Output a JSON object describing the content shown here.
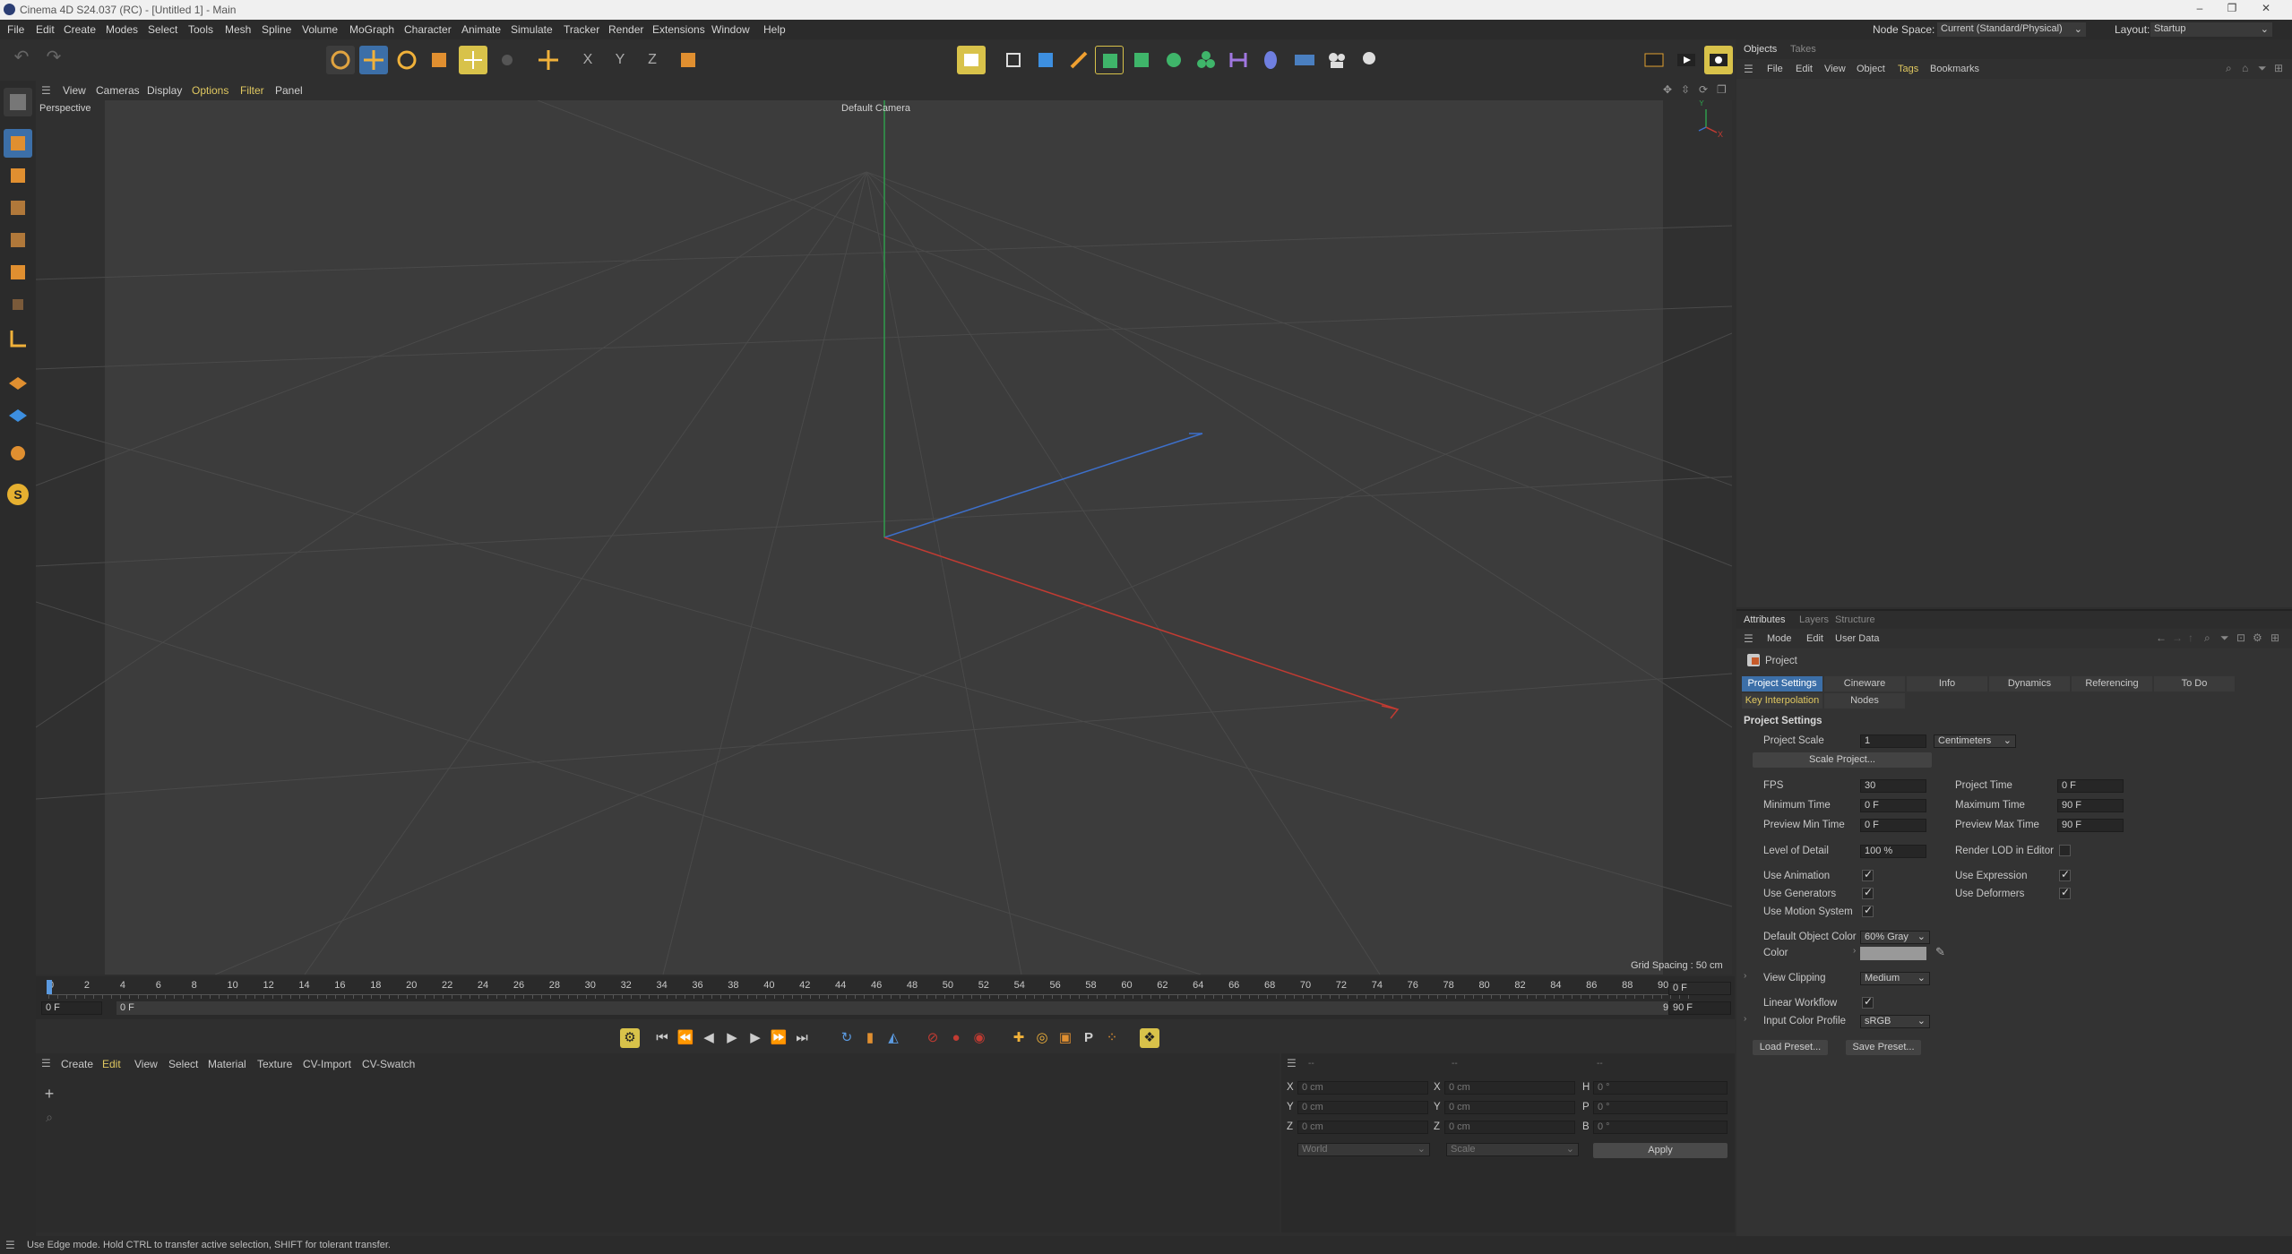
{
  "window": {
    "title": "Cinema 4D S24.037 (RC) - [Untitled 1] - Main"
  },
  "menu": {
    "items": [
      "File",
      "Edit",
      "Create",
      "Modes",
      "Select",
      "Tools",
      "Mesh",
      "Spline",
      "Volume",
      "MoGraph",
      "Character",
      "Animate",
      "Simulate",
      "Tracker",
      "Render",
      "Extensions",
      "Window",
      "Help"
    ],
    "node_space_label": "Node Space:",
    "node_space_value": "Current (Standard/Physical)",
    "layout_label": "Layout:",
    "layout_value": "Startup"
  },
  "viewport": {
    "menu": [
      "View",
      "Cameras",
      "Display",
      "Options",
      "Filter",
      "Panel"
    ],
    "projection": "Perspective",
    "camera": "Default Camera",
    "grid_spacing": "Grid Spacing : 50 cm",
    "axis_y": "Y",
    "axis_x": "X"
  },
  "timeline": {
    "ticks": [
      "0",
      "2",
      "4",
      "6",
      "8",
      "10",
      "12",
      "14",
      "16",
      "18",
      "20",
      "22",
      "24",
      "26",
      "28",
      "30",
      "32",
      "34",
      "36",
      "38",
      "40",
      "42",
      "44",
      "46",
      "48",
      "50",
      "52",
      "54",
      "56",
      "58",
      "60",
      "62",
      "64",
      "66",
      "68",
      "70",
      "72",
      "74",
      "76",
      "78",
      "80",
      "82",
      "84",
      "86",
      "88",
      "90"
    ],
    "current_frame": "0 F",
    "start_field": "0 F",
    "range_start": "0 F",
    "range_end": "90 F",
    "end_field": "90 F"
  },
  "material_manager": {
    "menu": [
      "Create",
      "Edit",
      "View",
      "Select",
      "Material",
      "Texture",
      "CV-Import",
      "CV-Swatch"
    ]
  },
  "coordinates": {
    "headers": [
      "--",
      "--",
      "--"
    ],
    "rows": [
      {
        "a": "X",
        "va": "0 cm",
        "b": "X",
        "vb": "0 cm",
        "c": "H",
        "vc": "0 °"
      },
      {
        "a": "Y",
        "va": "0 cm",
        "b": "Y",
        "vb": "0 cm",
        "c": "P",
        "vc": "0 °"
      },
      {
        "a": "Z",
        "va": "0 cm",
        "b": "Z",
        "vb": "0 cm",
        "c": "B",
        "vc": "0 °"
      }
    ],
    "mode1": "World",
    "mode2": "Scale",
    "apply": "Apply"
  },
  "status": {
    "text": "Use Edge mode. Hold CTRL to transfer active selection, SHIFT for tolerant transfer."
  },
  "objects_panel": {
    "tabs": [
      "Objects",
      "Takes"
    ],
    "menu": [
      "File",
      "Edit",
      "View",
      "Object",
      "Tags",
      "Bookmarks"
    ]
  },
  "attributes": {
    "tabs": [
      "Attributes",
      "Layers",
      "Structure"
    ],
    "menu": [
      "Mode",
      "Edit",
      "User Data"
    ],
    "object_label": "Project",
    "tabs_row1": [
      "Project Settings",
      "Cineware",
      "Info",
      "Dynamics",
      "Referencing",
      "To Do"
    ],
    "tabs_row2": [
      "Key Interpolation",
      "Nodes"
    ],
    "section": "Project Settings",
    "project_scale_label": "Project Scale",
    "project_scale_value": "1",
    "project_scale_unit": "Centimeters",
    "scale_project_btn": "Scale Project...",
    "fps_label": "FPS",
    "fps_value": "30",
    "project_time_label": "Project Time",
    "project_time_value": "0 F",
    "min_time_label": "Minimum Time",
    "min_time_value": "0 F",
    "max_time_label": "Maximum Time",
    "max_time_value": "90 F",
    "prev_min_label": "Preview Min Time",
    "prev_min_value": "0 F",
    "prev_max_label": "Preview Max Time",
    "prev_max_value": "90 F",
    "lod_label": "Level of Detail",
    "lod_value": "100 %",
    "render_lod_label": "Render LOD in Editor",
    "use_animation": "Use Animation",
    "use_expression": "Use Expression",
    "use_generators": "Use Generators",
    "use_deformers": "Use Deformers",
    "use_motion": "Use Motion System",
    "default_color_label": "Default Object Color",
    "default_color_value": "60% Gray",
    "color_label": "Color",
    "view_clipping_label": "View Clipping",
    "view_clipping_value": "Medium",
    "linear_workflow": "Linear Workflow",
    "input_color_label": "Input Color Profile",
    "input_color_value": "sRGB",
    "load_preset": "Load Preset...",
    "save_preset": "Save Preset..."
  },
  "colors": {
    "accent": "#3c6fa8",
    "axis_x": "#c23b32",
    "axis_y": "#2f9c4c",
    "axis_z": "#3d6fc9",
    "highlight": "#d8c24a"
  }
}
